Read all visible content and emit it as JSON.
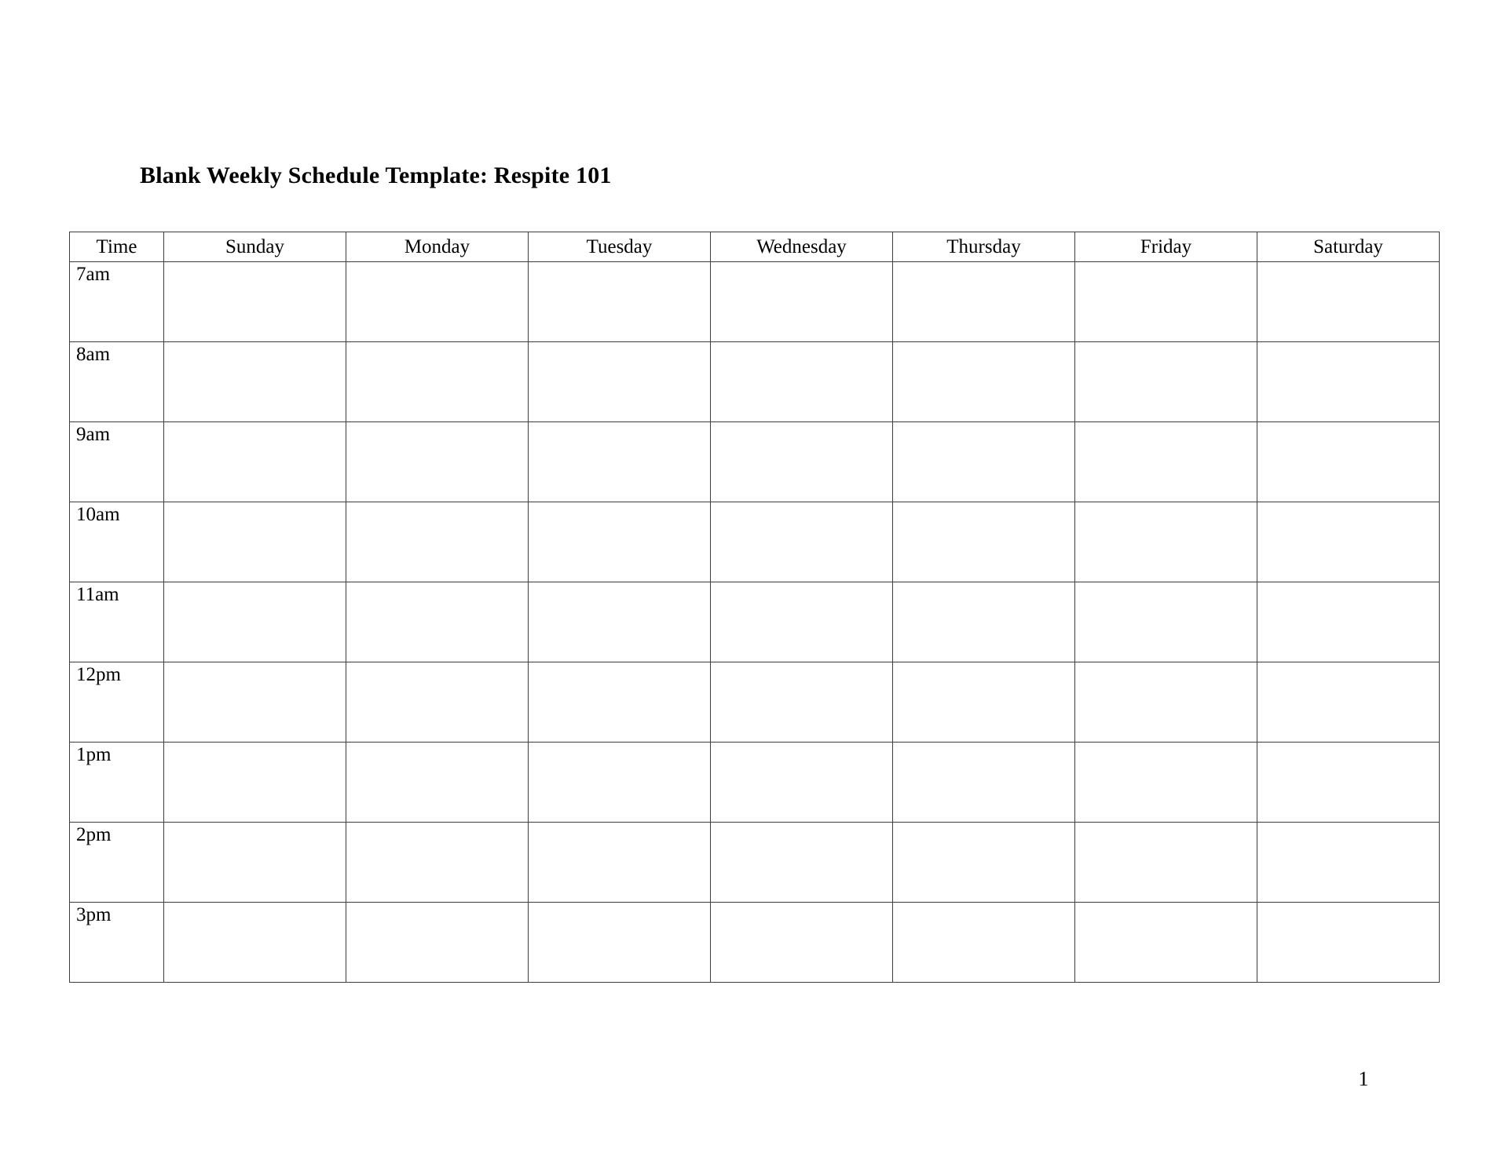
{
  "document": {
    "title": "Blank Weekly Schedule Template: Respite 101",
    "page_number": "1",
    "background_color": "#ffffff",
    "text_color": "#000000",
    "border_color": "#3d3d3d"
  },
  "schedule": {
    "columns": [
      {
        "key": "time",
        "label": "Time"
      },
      {
        "key": "sunday",
        "label": "Sunday"
      },
      {
        "key": "monday",
        "label": "Monday"
      },
      {
        "key": "tuesday",
        "label": "Tuesday"
      },
      {
        "key": "wednesday",
        "label": "Wednesday"
      },
      {
        "key": "thursday",
        "label": "Thursday"
      },
      {
        "key": "friday",
        "label": "Friday"
      },
      {
        "key": "saturday",
        "label": "Saturday"
      }
    ],
    "rows": [
      {
        "time": "7am",
        "sunday": "",
        "monday": "",
        "tuesday": "",
        "wednesday": "",
        "thursday": "",
        "friday": "",
        "saturday": ""
      },
      {
        "time": "8am",
        "sunday": "",
        "monday": "",
        "tuesday": "",
        "wednesday": "",
        "thursday": "",
        "friday": "",
        "saturday": ""
      },
      {
        "time": "9am",
        "sunday": "",
        "monday": "",
        "tuesday": "",
        "wednesday": "",
        "thursday": "",
        "friday": "",
        "saturday": ""
      },
      {
        "time": "10am",
        "sunday": "",
        "monday": "",
        "tuesday": "",
        "wednesday": "",
        "thursday": "",
        "friday": "",
        "saturday": ""
      },
      {
        "time": "11am",
        "sunday": "",
        "monday": "",
        "tuesday": "",
        "wednesday": "",
        "thursday": "",
        "friday": "",
        "saturday": ""
      },
      {
        "time": "12pm",
        "sunday": "",
        "monday": "",
        "tuesday": "",
        "wednesday": "",
        "thursday": "",
        "friday": "",
        "saturday": ""
      },
      {
        "time": "1pm",
        "sunday": "",
        "monday": "",
        "tuesday": "",
        "wednesday": "",
        "thursday": "",
        "friday": "",
        "saturday": ""
      },
      {
        "time": "2pm",
        "sunday": "",
        "monday": "",
        "tuesday": "",
        "wednesday": "",
        "thursday": "",
        "friday": "",
        "saturday": ""
      },
      {
        "time": "3pm",
        "sunday": "",
        "monday": "",
        "tuesday": "",
        "wednesday": "",
        "thursday": "",
        "friday": "",
        "saturday": ""
      }
    ]
  }
}
